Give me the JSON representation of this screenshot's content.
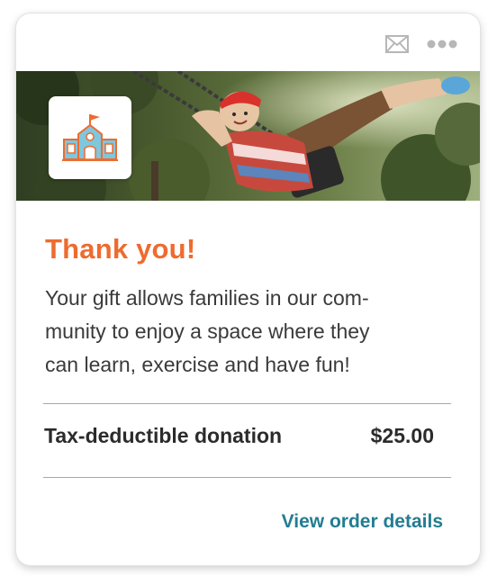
{
  "header": {
    "mail_icon": "envelope-icon",
    "more_icon": "more-dots-icon",
    "icon_color": "#b7b7b7"
  },
  "hero": {
    "photo": "child-on-swing-photo",
    "logo_icon": "school-building-icon",
    "logo_color": "#ee6b2f",
    "logo_accent": "#7ec7dd"
  },
  "content": {
    "title": "Thank you!",
    "message_lines": [
      "Your gift allows families in our com-",
      "munity to enjoy a space where they",
      "can learn, exercise and have fun!"
    ]
  },
  "donation": {
    "label": "Tax-deductible donation",
    "amount": "$25.00"
  },
  "footer": {
    "link_label": "View order details",
    "link_color": "#237d91"
  },
  "colors": {
    "accent": "#ee6b2f",
    "text": "#3a3a3a",
    "divider": "#a7a7a7"
  }
}
